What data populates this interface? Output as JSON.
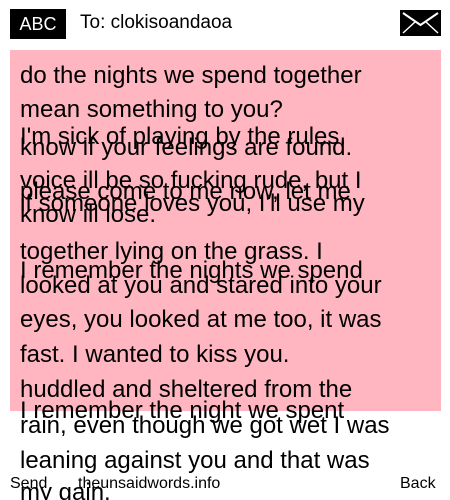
{
  "header": {
    "badge": "ABC",
    "to_label": "To: clokisoandaoa",
    "mail_icon": "envelope-icon"
  },
  "colors": {
    "message_background": "#ffb6c1",
    "badge_background": "#000000"
  },
  "message_lines": [
    "do the nights we spend together",
    "mean something to you?",
    "I'm sick of playing by the rules.",
    "know if your feelings are found.",
    "voice ill be so fucking rude, but I",
    "please come to me now, let me",
    "if someone loves you, I'll use my",
    "know ill lose.",
    "together lying on the grass. I",
    "I remember the nights we spend",
    "looked at you and stared into your",
    "eyes, you looked at me too, it was",
    "fast. I wanted to kiss you.",
    "huddled and sheltered from the",
    "I remember the night we spent",
    "rain, even though we got wet I was",
    "leaning against you and that was",
    "my gain."
  ],
  "footer": {
    "left": "Send",
    "center": "theunsaidwords.info",
    "right": "Back"
  }
}
